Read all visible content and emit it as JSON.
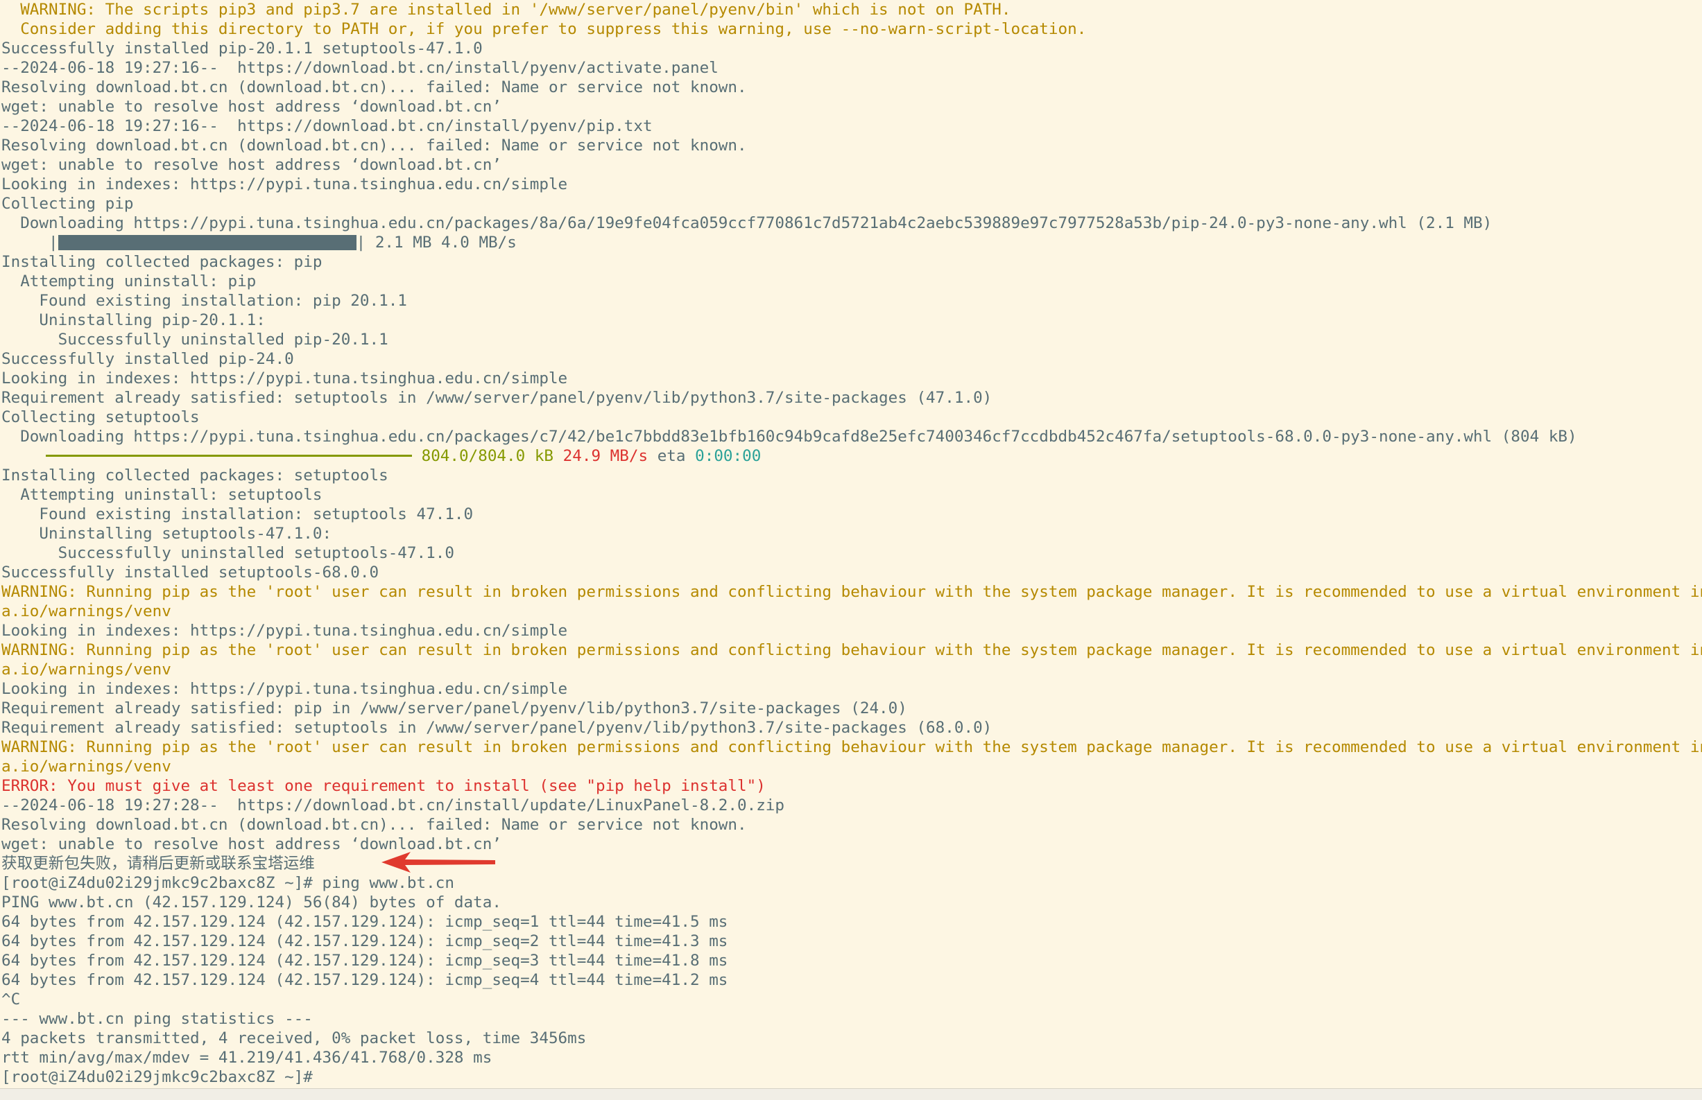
{
  "terminal": {
    "l01": "  WARNING: The scripts pip3 and pip3.7 are installed in '/www/server/panel/pyenv/bin' which is not on PATH.",
    "l02": "  Consider adding this directory to PATH or, if you prefer to suppress this warning, use --no-warn-script-location.",
    "l03": "Successfully installed pip-20.1.1 setuptools-47.1.0",
    "l04": "--2024-06-18 19:27:16--  https://download.bt.cn/install/pyenv/activate.panel",
    "l05": "Resolving download.bt.cn (download.bt.cn)... failed: Name or service not known.",
    "l06": "wget: unable to resolve host address ‘download.bt.cn’",
    "l07": "--2024-06-18 19:27:16--  https://download.bt.cn/install/pyenv/pip.txt",
    "l08": "Resolving download.bt.cn (download.bt.cn)... failed: Name or service not known.",
    "l09": "wget: unable to resolve host address ‘download.bt.cn’",
    "l10": "Looking in indexes: https://pypi.tuna.tsinghua.edu.cn/simple",
    "l11": "Collecting pip",
    "l12": "  Downloading https://pypi.tuna.tsinghua.edu.cn/packages/8a/6a/19e9fe04fca059ccf770861c7d5721ab4c2aebc539889e97c7977528a53b/pip-24.0-py3-none-any.whl (2.1 MB)",
    "l13_prefix": "     |",
    "l13_suffix": "| 2.1 MB 4.0 MB/s",
    "l14": "Installing collected packages: pip",
    "l15": "  Attempting uninstall: pip",
    "l16": "    Found existing installation: pip 20.1.1",
    "l17": "    Uninstalling pip-20.1.1:",
    "l18": "      Successfully uninstalled pip-20.1.1",
    "l19": "Successfully installed pip-24.0",
    "l20": "Looking in indexes: https://pypi.tuna.tsinghua.edu.cn/simple",
    "l21": "Requirement already satisfied: setuptools in /www/server/panel/pyenv/lib/python3.7/site-packages (47.1.0)",
    "l22": "Collecting setuptools",
    "l23": "  Downloading https://pypi.tuna.tsinghua.edu.cn/packages/c7/42/be1c7bbdd83e1bfb160c94b9cafd8e25efc7400346cf7ccdbdb452c467fa/setuptools-68.0.0-py3-none-any.whl (804 kB)",
    "l24_size": " 804.0/804.0 kB",
    "l24_speed": "24.9 MB/s",
    "l24_eta_label": "eta",
    "l24_eta": "0:00:00",
    "l25": "Installing collected packages: setuptools",
    "l26": "  Attempting uninstall: setuptools",
    "l27": "    Found existing installation: setuptools 47.1.0",
    "l28": "    Uninstalling setuptools-47.1.0:",
    "l29": "      Successfully uninstalled setuptools-47.1.0",
    "l30": "Successfully installed setuptools-68.0.0",
    "l31": "WARNING: Running pip as the 'root' user can result in broken permissions and conflicting behaviour with the system package manager. It is recommended to use a virtual environment instead",
    "l32": "a.io/warnings/venv",
    "l33": "Looking in indexes: https://pypi.tuna.tsinghua.edu.cn/simple",
    "l34": "WARNING: Running pip as the 'root' user can result in broken permissions and conflicting behaviour with the system package manager. It is recommended to use a virtual environment instead",
    "l35": "a.io/warnings/venv",
    "l36": "Looking in indexes: https://pypi.tuna.tsinghua.edu.cn/simple",
    "l37": "Requirement already satisfied: pip in /www/server/panel/pyenv/lib/python3.7/site-packages (24.0)",
    "l38": "Requirement already satisfied: setuptools in /www/server/panel/pyenv/lib/python3.7/site-packages (68.0.0)",
    "l39": "WARNING: Running pip as the 'root' user can result in broken permissions and conflicting behaviour with the system package manager. It is recommended to use a virtual environment instead",
    "l40": "a.io/warnings/venv",
    "l41": "ERROR: You must give at least one requirement to install (see \"pip help install\")",
    "l42": "--2024-06-18 19:27:28--  https://download.bt.cn/install/update/LinuxPanel-8.2.0.zip",
    "l43": "Resolving download.bt.cn (download.bt.cn)... failed: Name or service not known.",
    "l44": "wget: unable to resolve host address ‘download.bt.cn’",
    "l45": "获取更新包失败，请稍后更新或联系宝塔运维",
    "l46": "[root@iZ4du02i29jmkc9c2baxc8Z ~]# ping www.bt.cn",
    "l47": "PING www.bt.cn (42.157.129.124) 56(84) bytes of data.",
    "l48": "64 bytes from 42.157.129.124 (42.157.129.124): icmp_seq=1 ttl=44 time=41.5 ms",
    "l49": "64 bytes from 42.157.129.124 (42.157.129.124): icmp_seq=2 ttl=44 time=41.3 ms",
    "l50": "64 bytes from 42.157.129.124 (42.157.129.124): icmp_seq=3 ttl=44 time=41.8 ms",
    "l51": "64 bytes from 42.157.129.124 (42.157.129.124): icmp_seq=4 ttl=44 time=41.2 ms",
    "l52": "^C",
    "l53": "--- www.bt.cn ping statistics ---",
    "l54": "4 packets transmitted, 4 received, 0% packet loss, time 3456ms",
    "l55": "rtt min/avg/max/mdev = 41.219/41.436/41.768/0.328 ms",
    "l56": "[root@iZ4du02i29jmkc9c2baxc8Z ~]# "
  },
  "progress": {
    "pip_download": 1.0,
    "setuptools_download": 1.0
  },
  "colors": {
    "background": "#fdf6e3",
    "text": "#586e75",
    "warning": "#b58900",
    "error": "#dc322f",
    "progress": "#859900",
    "eta": "#2aa198",
    "annotation_arrow": "#e03a2e"
  },
  "annotation": {
    "icon": "arrow-left-icon"
  }
}
